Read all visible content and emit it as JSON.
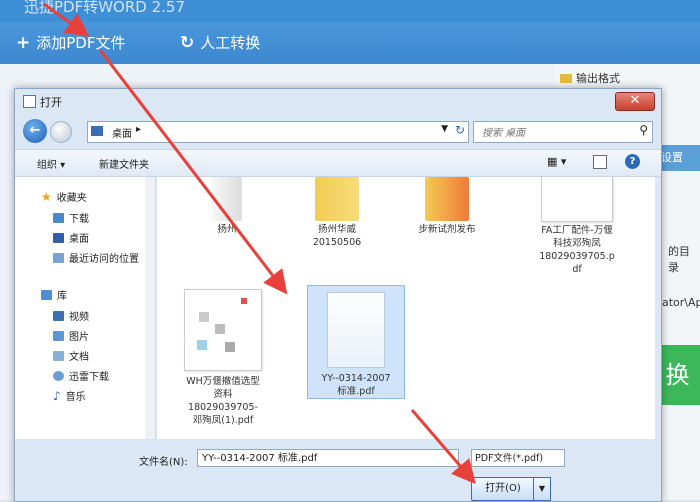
{
  "app": {
    "title": "迅捷PDF转WORD 2.57",
    "add_pdf_label": "添加PDF文件",
    "human_convert_label": "人工转换",
    "output_format_label": "输出格式",
    "right_panel": {
      "blue_tab": "设置",
      "dir_label": "的目录",
      "path_text": "ator\\Ap",
      "green_text": "换"
    }
  },
  "dialog": {
    "title": "打开",
    "address": {
      "crumb": "桌面",
      "separator": "▸"
    },
    "search_placeholder": "搜索 桌面",
    "toolbar": {
      "organize": "组织 ▾",
      "new_folder": "新建文件夹"
    },
    "nav": {
      "favorites": "收藏夹",
      "items": [
        "下载",
        "桌面",
        "最近访问的位置"
      ],
      "library": "库",
      "lib_items": [
        "视频",
        "图片",
        "文档",
        "迅雷下载",
        "音乐"
      ]
    },
    "files": [
      {
        "name": "扬州"
      },
      {
        "name": "扬州华威\n20150506"
      },
      {
        "name": "步新试剂发布"
      },
      {
        "name": "FA工厂配件-万偃\n科技邓殉凤\n18029039705.p\ndf"
      },
      {
        "name": "WH万偃撤值选型\n资料\n18029039705-\n邓殉凤(1).pdf"
      },
      {
        "name": "YY--0314-2007\n标准.pdf"
      }
    ],
    "filename_label": "文件名(N):",
    "filename_value": "YY--0314-2007 标准.pdf",
    "filetype_value": "PDF文件(*.pdf)",
    "open_label": "打开(O)",
    "open_dropdown": "▼",
    "close_glyph": "✕"
  },
  "colors": {
    "accent": "#3f8fd6",
    "arrow": "#e8403a"
  }
}
